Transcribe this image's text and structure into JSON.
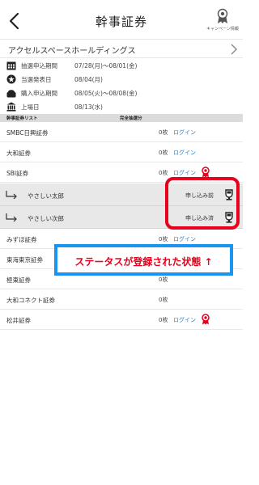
{
  "header": {
    "title": "幹事証券",
    "campaign_label": "キャンペーン情報"
  },
  "company": {
    "name": "アクセルスペースホールディングス"
  },
  "schedule": [
    {
      "icon": "calendar-icon",
      "label": "抽選申込期間",
      "value": "07/28(月)〜08/01(金)"
    },
    {
      "icon": "badge-icon",
      "label": "当選発表日",
      "value": "08/04(月)"
    },
    {
      "icon": "wallet-icon",
      "label": "購入申込期間",
      "value": "08/05(火)〜08/08(金)"
    },
    {
      "icon": "bank-icon",
      "label": "上場日",
      "value": "08/13(水)"
    }
  ],
  "list_header": {
    "left": "幹事証券リスト",
    "right": "完全抽選分"
  },
  "rows": [
    {
      "name": "SMBC日興証券",
      "count": "0枚",
      "login": "ログイン",
      "ribbon": false
    },
    {
      "name": "大和証券",
      "count": "0枚",
      "login": "ログイン",
      "ribbon": false
    },
    {
      "name": "SBI証券",
      "count": "0枚",
      "login": "ログイン",
      "ribbon": true
    },
    {
      "name": "やさしい太郎",
      "status": "申し込み前",
      "sub": true
    },
    {
      "name": "やさしい次郎",
      "status": "申し込み済",
      "sub": true
    },
    {
      "name": "みずほ証券",
      "count": "0枚",
      "login": "ログイン",
      "ribbon": false
    },
    {
      "name": "東海東京証券",
      "count": "",
      "login": "",
      "ribbon": false
    },
    {
      "name": "極東証券",
      "count": "0枚",
      "login": "",
      "ribbon": false
    },
    {
      "name": "大和コネクト証券",
      "count": "0枚",
      "login": "",
      "ribbon": false
    },
    {
      "name": "松井証券",
      "count": "0枚",
      "login": "ログイン",
      "ribbon": true
    }
  ],
  "annotation": {
    "text": "ステータスが登録された状態 ↑"
  },
  "colors": {
    "link": "#1a7bd8",
    "annotation_red": "#e8001c",
    "annotation_blue": "#1a94f2",
    "ribbon": "#e8001c"
  }
}
